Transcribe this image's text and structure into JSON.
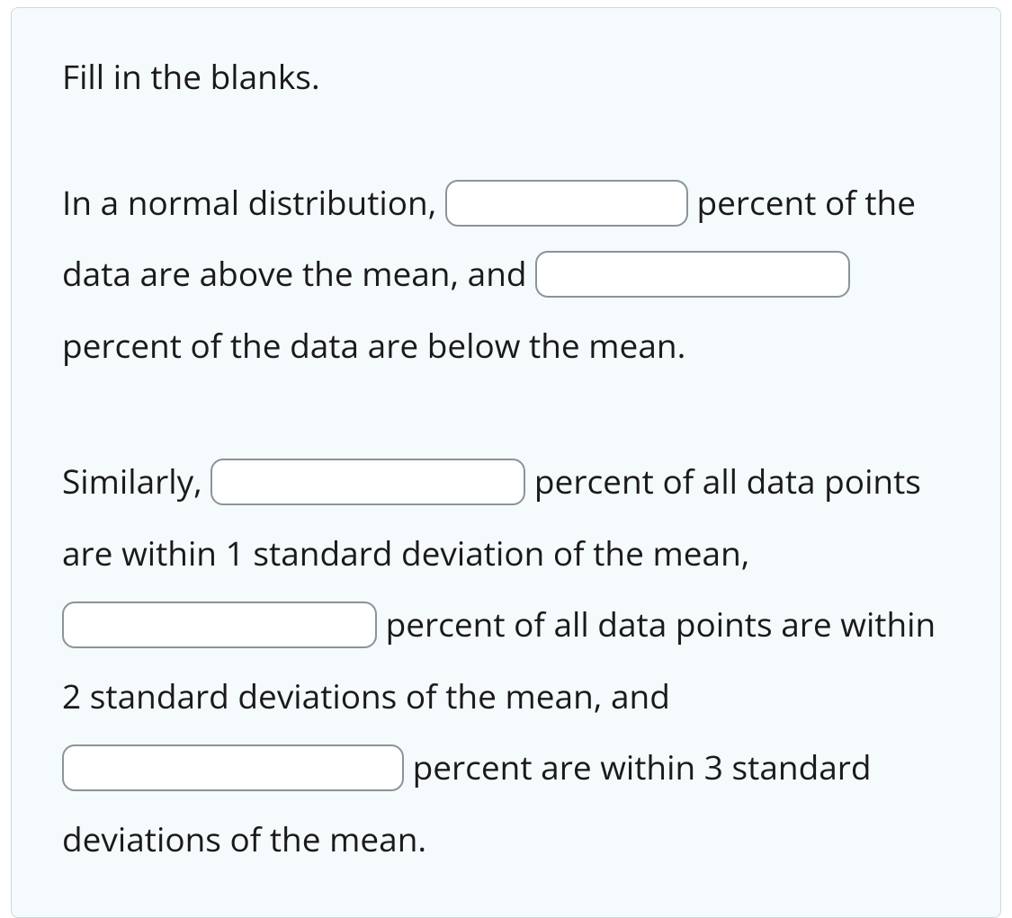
{
  "prompt": "Fill in the blanks.",
  "paragraph1": {
    "text1": "In a normal distribution, ",
    "text2": " percent of the data are above the mean, and ",
    "text3": " percent of the data are below the mean."
  },
  "paragraph2": {
    "text1": "Similarly, ",
    "text2": " percent of all data points are within 1 standard deviation of the mean, ",
    "text3": " percent of all data points are within 2 standard deviations of the mean, and ",
    "text4": " percent are within 3 standard deviations of the mean."
  },
  "blanks": {
    "blank1": "",
    "blank2": "",
    "blank3": "",
    "blank4": "",
    "blank5": ""
  }
}
